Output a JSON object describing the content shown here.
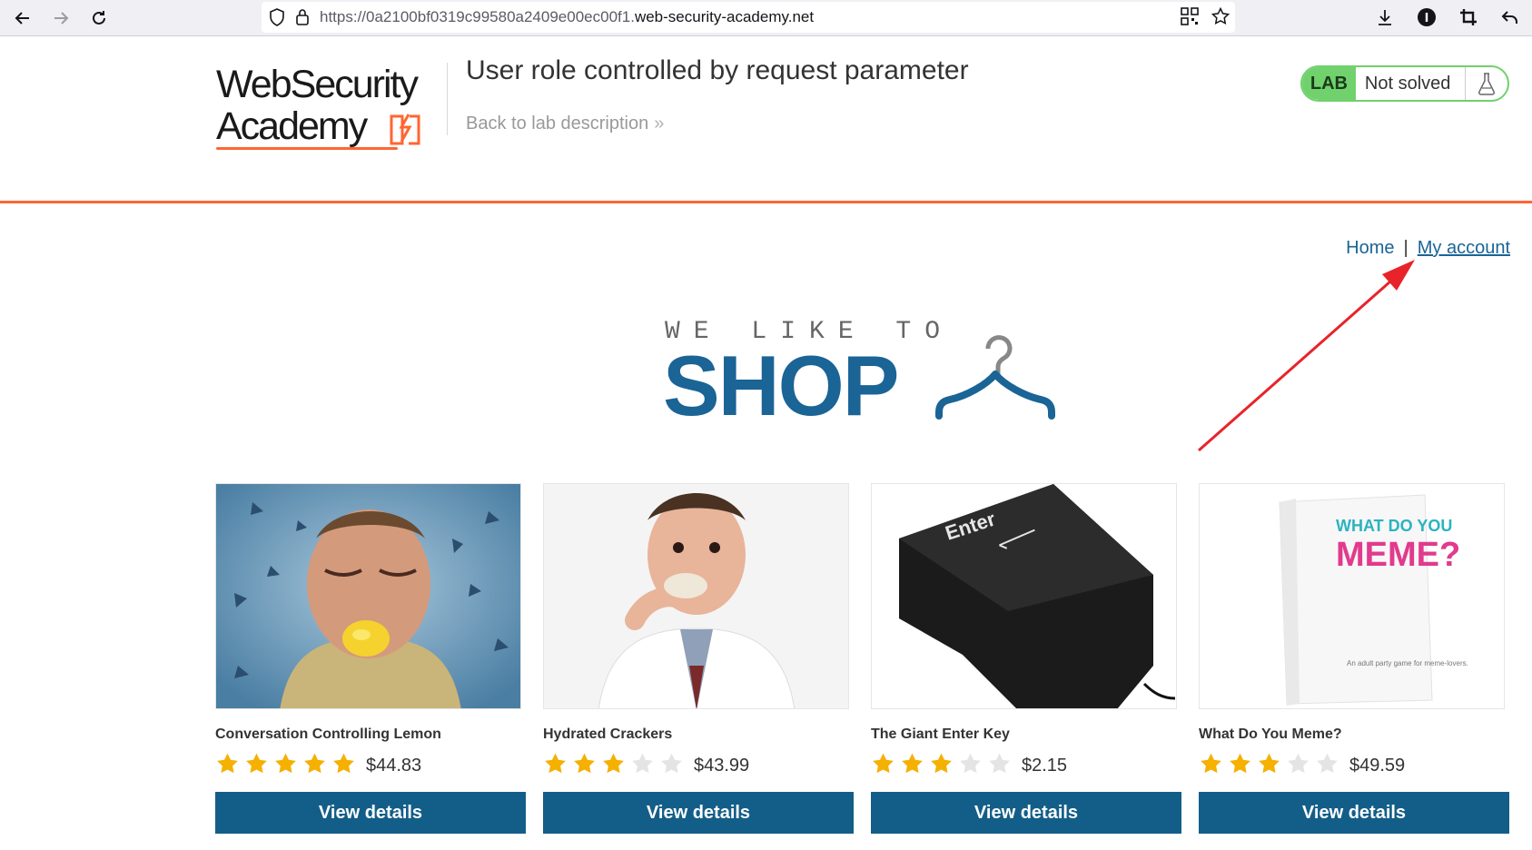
{
  "browser": {
    "url_prefix": "https://0a2100bf0319c99580a2409e00ec00f1.",
    "url_domain": "web-security-academy.net"
  },
  "lab": {
    "logo_line1": "WebSecurity",
    "logo_line2": "Academy",
    "title": "User role controlled by request parameter",
    "back_link": "Back to lab description",
    "badge": "LAB",
    "status": "Not solved"
  },
  "nav": {
    "home": "Home",
    "separator": "|",
    "my_account": "My account"
  },
  "hero": {
    "small": "WE LIKE TO",
    "big": "SHOP"
  },
  "products": [
    {
      "name": "Conversation Controlling Lemon",
      "rating": 5,
      "price": "$44.83",
      "button": "View details"
    },
    {
      "name": "Hydrated Crackers",
      "rating": 3,
      "price": "$43.99",
      "button": "View details"
    },
    {
      "name": "The Giant Enter Key",
      "rating": 3,
      "price": "$2.15",
      "button": "View details"
    },
    {
      "name": "What Do You Meme?",
      "rating": 3,
      "price": "$49.59",
      "button": "View details",
      "box_line1": "WHAT DO YOU",
      "box_line2": "MEME?",
      "box_caption": "An adult party game for meme-lovers."
    }
  ],
  "product_images": {
    "enter_key_label": "Enter"
  },
  "colors": {
    "accent_orange": "#ff6633",
    "link_blue": "#1a6496",
    "button_blue": "#135e88",
    "lab_green": "#70d16d",
    "star_gold": "#f5b000",
    "annotation_red": "#e8232a"
  }
}
